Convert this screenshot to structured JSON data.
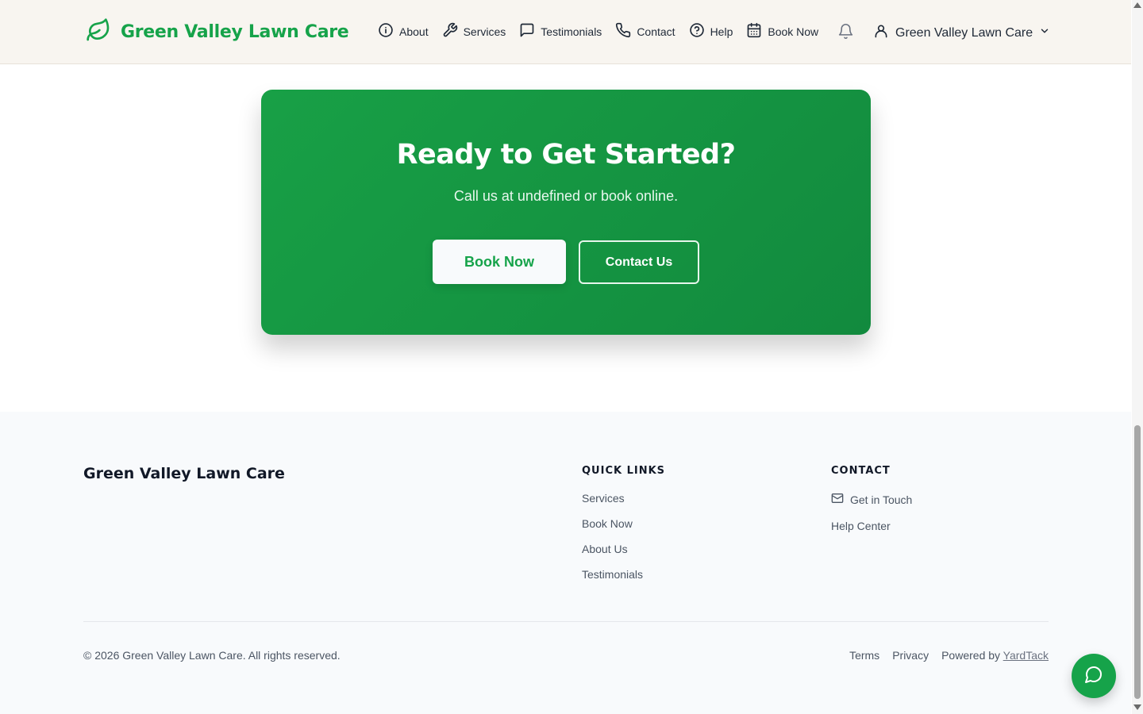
{
  "header": {
    "brand": "Green Valley Lawn Care",
    "nav": [
      {
        "label": "About",
        "icon": "info-icon"
      },
      {
        "label": "Services",
        "icon": "wrench-icon"
      },
      {
        "label": "Testimonials",
        "icon": "message-icon"
      },
      {
        "label": "Contact",
        "icon": "phone-icon"
      },
      {
        "label": "Help",
        "icon": "help-circle-icon"
      },
      {
        "label": "Book Now",
        "icon": "calendar-icon"
      }
    ],
    "notifications_icon": "bell-icon",
    "user_menu_label": "Green Valley Lawn Care"
  },
  "cta": {
    "title": "Ready to Get Started?",
    "subtitle": "Call us at undefined or book online.",
    "primary_button": "Book Now",
    "secondary_button": "Contact Us"
  },
  "footer": {
    "brand": "Green Valley Lawn Care",
    "quick_links": {
      "heading": "QUICK LINKS",
      "items": [
        "Services",
        "Book Now",
        "About Us",
        "Testimonials"
      ]
    },
    "contact": {
      "heading": "CONTACT",
      "items": [
        "Get in Touch",
        "Help Center"
      ]
    },
    "copyright": "© 2026 Green Valley Lawn Care. All rights reserved.",
    "legal": {
      "terms": "Terms",
      "privacy": "Privacy",
      "powered_by": "Powered by",
      "powered_by_link": "YardTack"
    }
  },
  "colors": {
    "brand_green": "#16a34a",
    "cta_gradient_start": "#18a046",
    "cta_gradient_end": "#128a3e",
    "header_bg": "#f8f5f0",
    "footer_bg": "#f8fafc"
  }
}
